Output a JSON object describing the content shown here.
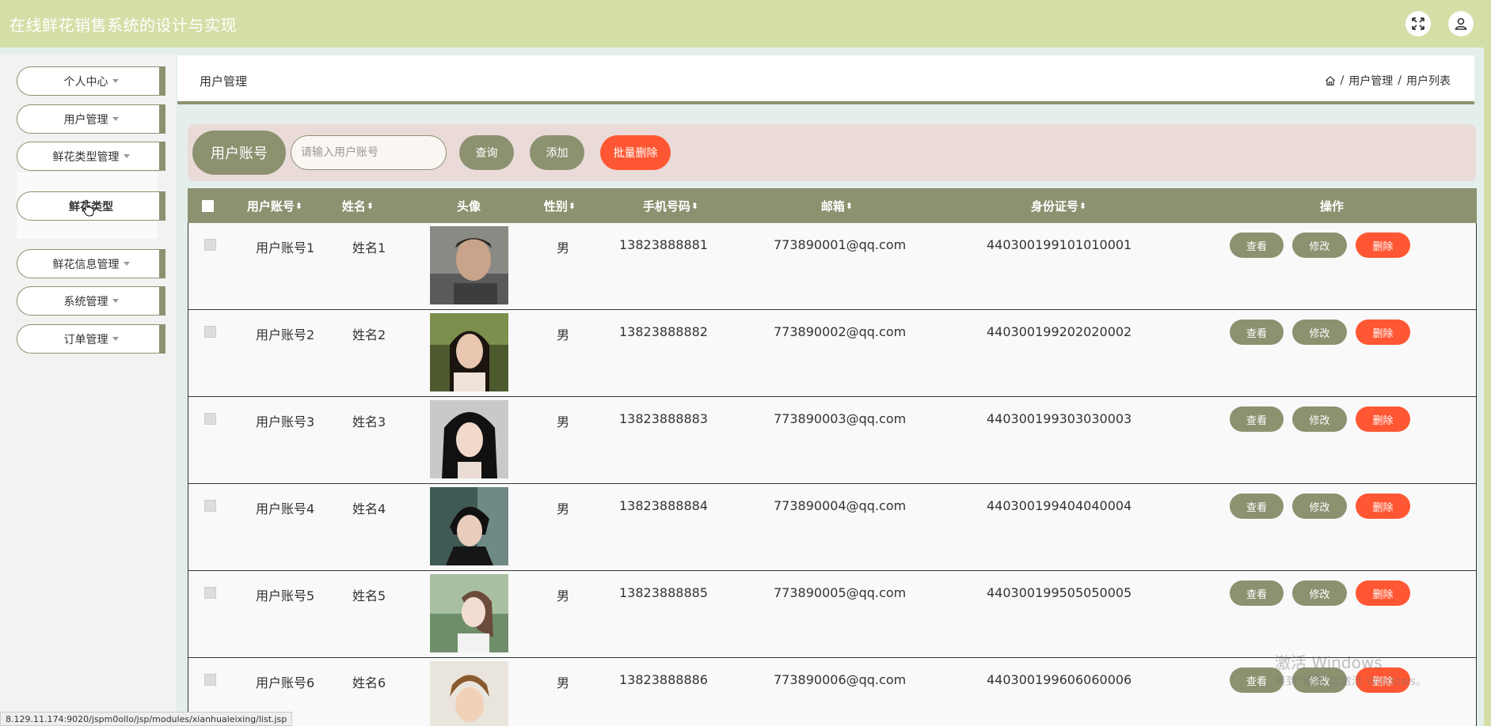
{
  "app": {
    "title": "在线鲜花销售系统的设计与实现"
  },
  "header_icons": {
    "fullscreen": "fullscreen-icon",
    "user": "user-icon"
  },
  "sidebar": {
    "items": [
      {
        "label": "个人中心"
      },
      {
        "label": "用户管理"
      },
      {
        "label": "鲜花类型管理"
      },
      {
        "label": "鲜花信息管理"
      },
      {
        "label": "系统管理"
      },
      {
        "label": "订单管理"
      }
    ],
    "active_sub": "鲜花类型"
  },
  "page": {
    "title": "用户管理",
    "breadcrumb": [
      "用户管理",
      "用户列表"
    ],
    "breadcrumb_sep": "/"
  },
  "search": {
    "label": "用户账号",
    "placeholder": "请输入用户账号",
    "query_btn": "查询",
    "add_btn": "添加",
    "batch_delete_btn": "批量删除"
  },
  "table": {
    "columns": [
      "用户账号",
      "姓名",
      "头像",
      "性别",
      "手机号码",
      "邮箱",
      "身份证号",
      "操作"
    ],
    "sort_glyph": "⬍",
    "actions": {
      "view": "查看",
      "edit": "修改",
      "delete": "删除"
    },
    "rows": [
      {
        "account": "用户账号1",
        "name": "姓名1",
        "gender": "男",
        "phone": "13823888881",
        "email": "773890001@qq.com",
        "id_card": "440300199101010001"
      },
      {
        "account": "用户账号2",
        "name": "姓名2",
        "gender": "男",
        "phone": "13823888882",
        "email": "773890002@qq.com",
        "id_card": "440300199202020002"
      },
      {
        "account": "用户账号3",
        "name": "姓名3",
        "gender": "男",
        "phone": "13823888883",
        "email": "773890003@qq.com",
        "id_card": "440300199303030003"
      },
      {
        "account": "用户账号4",
        "name": "姓名4",
        "gender": "男",
        "phone": "13823888884",
        "email": "773890004@qq.com",
        "id_card": "440300199404040004"
      },
      {
        "account": "用户账号5",
        "name": "姓名5",
        "gender": "男",
        "phone": "13823888885",
        "email": "773890005@qq.com",
        "id_card": "440300199505050005"
      },
      {
        "account": "用户账号6",
        "name": "姓名6",
        "gender": "男",
        "phone": "13823888886",
        "email": "773890006@qq.com",
        "id_card": "440300199606060006"
      }
    ]
  },
  "status_url": "8.129.11.174:9020/jspm0ollo/jsp/modules/xianhualeixing/list.jsp",
  "watermark": {
    "line1": "激活 Windows",
    "line2": "转到\"设置\"以激活 Windows。"
  },
  "colors": {
    "header": "#d3dfa6",
    "accent": "#8c9170",
    "danger": "#ff5733",
    "search_bg": "#eadbd8",
    "page_bg": "#e4efeb"
  }
}
